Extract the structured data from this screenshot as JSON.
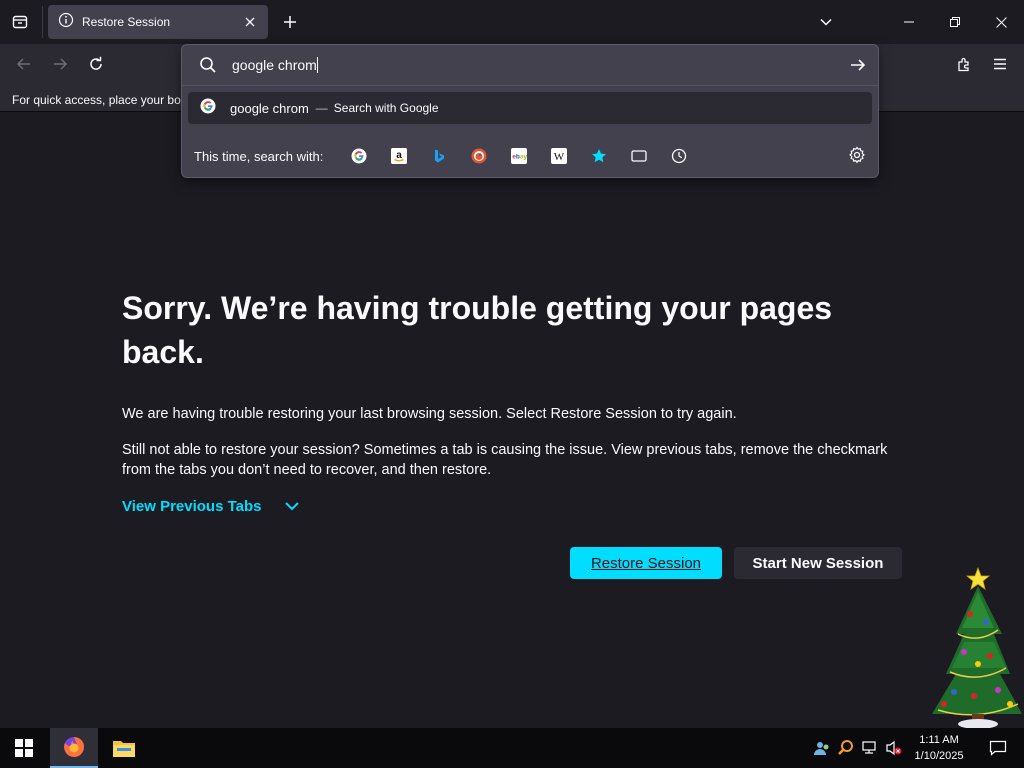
{
  "tab": {
    "title": "Restore Session"
  },
  "bookmarks_bar": {
    "text": "For quick access, place your boo"
  },
  "url_bar": {
    "value": "google chrom"
  },
  "suggestion": {
    "text": "google chrom",
    "separator": "—",
    "action": "Search with Google"
  },
  "one_off": {
    "label": "This time, search with:",
    "engines": [
      "google-icon",
      "amazon-icon",
      "bing-icon",
      "duckduckgo-icon",
      "ebay-icon",
      "wikipedia-icon",
      "bookmarks-icon",
      "tabs-icon",
      "history-icon"
    ]
  },
  "page": {
    "headline": "Sorry. We’re having trouble getting your pages back.",
    "para1": "We are having trouble restoring your last browsing session. Select Restore Session to try again.",
    "para2": "Still not able to restore your session? Sometimes a tab is causing the issue. View previous tabs, remove the checkmark from the tabs you don’t need to recover, and then restore.",
    "view_previous": "View Previous Tabs",
    "restore_button": "Restore Session",
    "new_session_button": "Start New Session"
  },
  "taskbar": {
    "time": "1:11 AM",
    "date": "1/10/2025"
  },
  "colors": {
    "accent": "#00ddff",
    "background": "#1c1b22",
    "toolbar": "#2b2a33",
    "popup": "#42414d"
  }
}
